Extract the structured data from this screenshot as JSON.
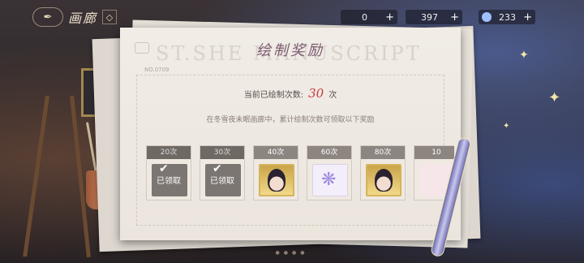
{
  "topbar": {
    "home_icon": "quill-icon",
    "title": "画廊",
    "title_icon": "gallery-icon",
    "resources": [
      {
        "value": "0",
        "icon": "coin-icon"
      },
      {
        "value": "397",
        "icon": "crystal-icon"
      },
      {
        "value": "233",
        "icon": "diamond-icon"
      }
    ]
  },
  "panel": {
    "watermark": "ST.SHE MANUSCRIPT",
    "title": "绘制奖励",
    "serial": "NO.0709",
    "count_prefix": "当前已绘制次数:",
    "count_value": "30",
    "count_suffix": "次",
    "description": "在冬雪夜未眠画廊中，累计绘制次数可领取以下奖励"
  },
  "rewards": [
    {
      "label": "20次",
      "claimed": true,
      "claimed_text": "已领取",
      "item": "gift-icon"
    },
    {
      "label": "30次",
      "claimed": true,
      "claimed_text": "已领取",
      "item": "gift-icon"
    },
    {
      "label": "40次",
      "claimed": false,
      "item": "portrait-card"
    },
    {
      "label": "60次",
      "claimed": false,
      "item": "butterfly-item"
    },
    {
      "label": "80次",
      "claimed": false,
      "item": "portrait-card"
    },
    {
      "label": "10",
      "claimed": false,
      "item": "pink-item"
    }
  ],
  "pager": "●●●●"
}
